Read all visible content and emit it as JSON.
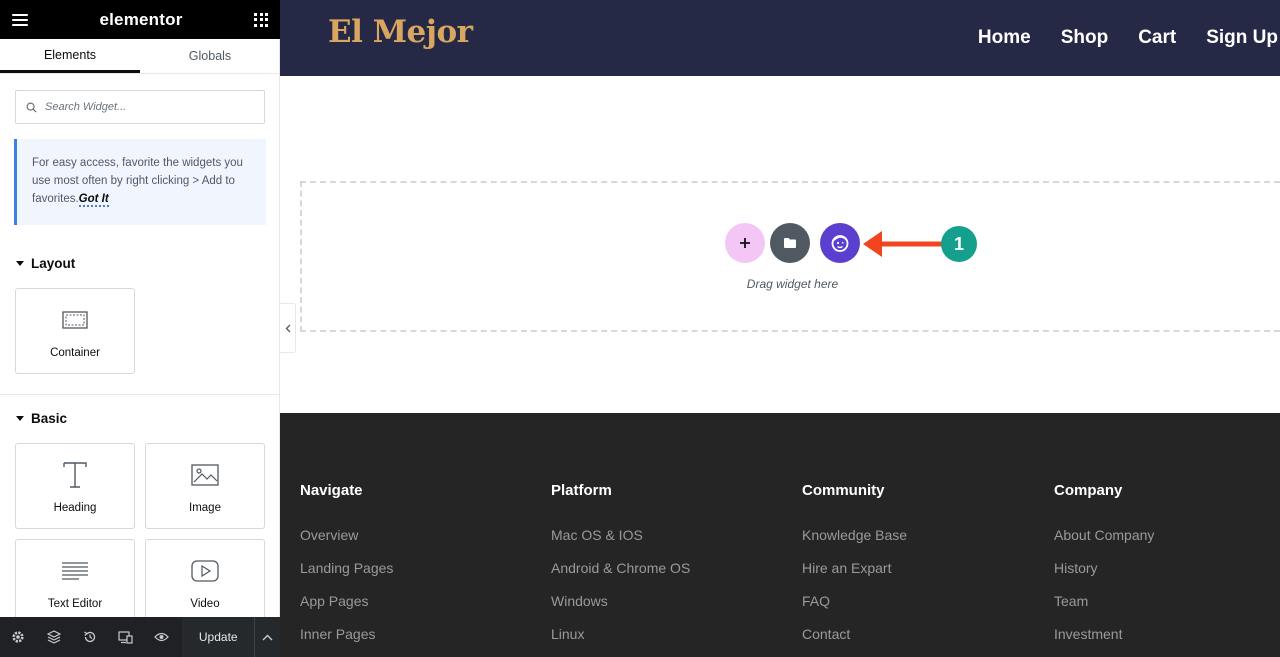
{
  "editor": {
    "logo": "elementor",
    "tabs": [
      "Elements",
      "Globals"
    ],
    "search_placeholder": "Search Widget...",
    "tip_text": "For easy access, favorite the widgets you use most often by right clicking > Add to favorites.",
    "tip_link": "Got It",
    "categories": {
      "layout": {
        "title": "Layout",
        "widgets": [
          "Container"
        ]
      },
      "basic": {
        "title": "Basic",
        "widgets": [
          "Heading",
          "Image",
          "Text Editor",
          "Video"
        ]
      }
    },
    "footer": {
      "icons": [
        "settings-icon",
        "layers-icon",
        "history-icon",
        "responsive-icon",
        "preview-eye-icon"
      ],
      "update_label": "Update"
    }
  },
  "site": {
    "logo": "El Mejor",
    "nav": [
      "Home",
      "Shop",
      "Cart",
      "Sign Up"
    ],
    "drop_zone_text": "Drag widget here",
    "annotation_number": "1",
    "footer_columns": [
      {
        "title": "Navigate",
        "links": [
          "Overview",
          "Landing Pages",
          "App Pages",
          "Inner Pages"
        ]
      },
      {
        "title": "Platform",
        "links": [
          "Mac OS & IOS",
          "Android & Chrome OS",
          "Windows",
          "Linux"
        ]
      },
      {
        "title": "Community",
        "links": [
          "Knowledge Base",
          "Hire an Expart",
          "FAQ",
          "Contact"
        ]
      },
      {
        "title": "Company",
        "links": [
          "About Company",
          "History",
          "Team",
          "Investment"
        ]
      }
    ]
  },
  "colors": {
    "header_bg": "#262945",
    "logo_gold": "#d9a65f",
    "footer_bg": "#252525",
    "add_button": "#f3c6f5",
    "template_button": "#505862",
    "ai_button": "#5b40d0",
    "arrow": "#f1441f",
    "badge": "#14a08c"
  }
}
